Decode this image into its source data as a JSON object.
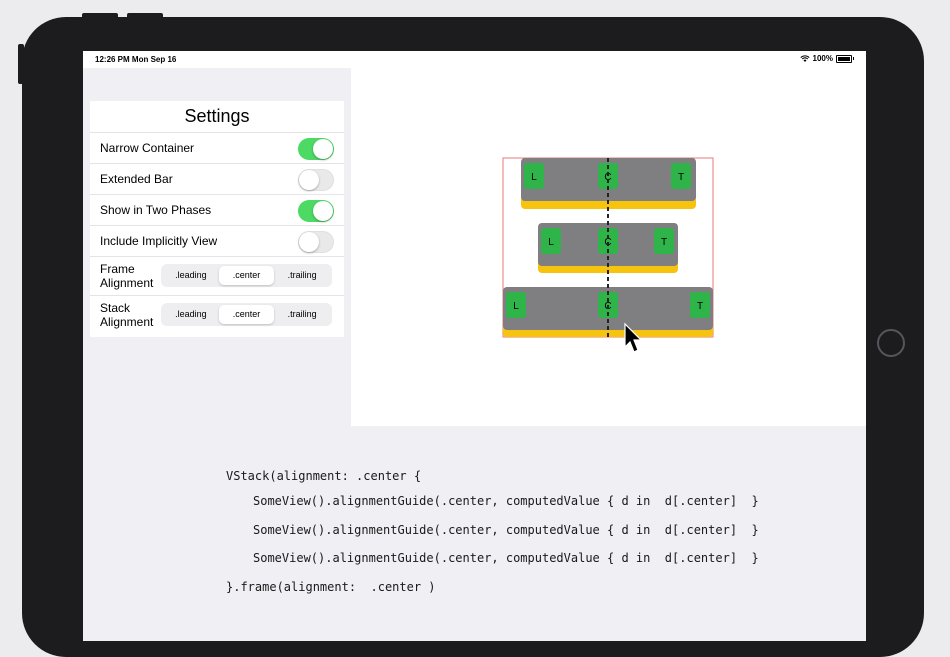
{
  "status_bar": {
    "time": "12:26 PM  Mon Sep 16",
    "battery": "100%"
  },
  "settings": {
    "title": "Settings",
    "toggles": [
      {
        "label": "Narrow Container",
        "on": true
      },
      {
        "label": "Extended Bar",
        "on": false
      },
      {
        "label": "Show in Two Phases",
        "on": true
      },
      {
        "label": "Include Implicitly View",
        "on": false
      }
    ],
    "frame_alignment": {
      "label_line1": "Frame",
      "label_line2": "Alignment",
      "options": [
        ".leading",
        ".center",
        ".trailing"
      ],
      "selected": ".center"
    },
    "stack_alignment": {
      "label_line1": "Stack",
      "label_line2": "Alignment",
      "options": [
        ".leading",
        ".center",
        ".trailing"
      ],
      "selected": ".center"
    }
  },
  "preview": {
    "rows": [
      {
        "left": "L",
        "center": "C",
        "right": "T"
      },
      {
        "left": "L",
        "center": "C",
        "right": "T"
      },
      {
        "left": "L",
        "center": "C",
        "right": "T"
      }
    ],
    "colors": {
      "bar": "#7f7f82",
      "underbar": "#f6c30f",
      "label": "#2fb44a",
      "frame": "#e87a7a"
    }
  },
  "code": {
    "line1": "VStack(alignment: .center {",
    "line2": "SomeView().alignmentGuide(.center, computedValue { d in  d[.center]  }",
    "line3": "SomeView().alignmentGuide(.center, computedValue { d in  d[.center]  }",
    "line4": "SomeView().alignmentGuide(.center, computedValue { d in  d[.center]  }",
    "line5": "}.frame(alignment:  .center )"
  }
}
